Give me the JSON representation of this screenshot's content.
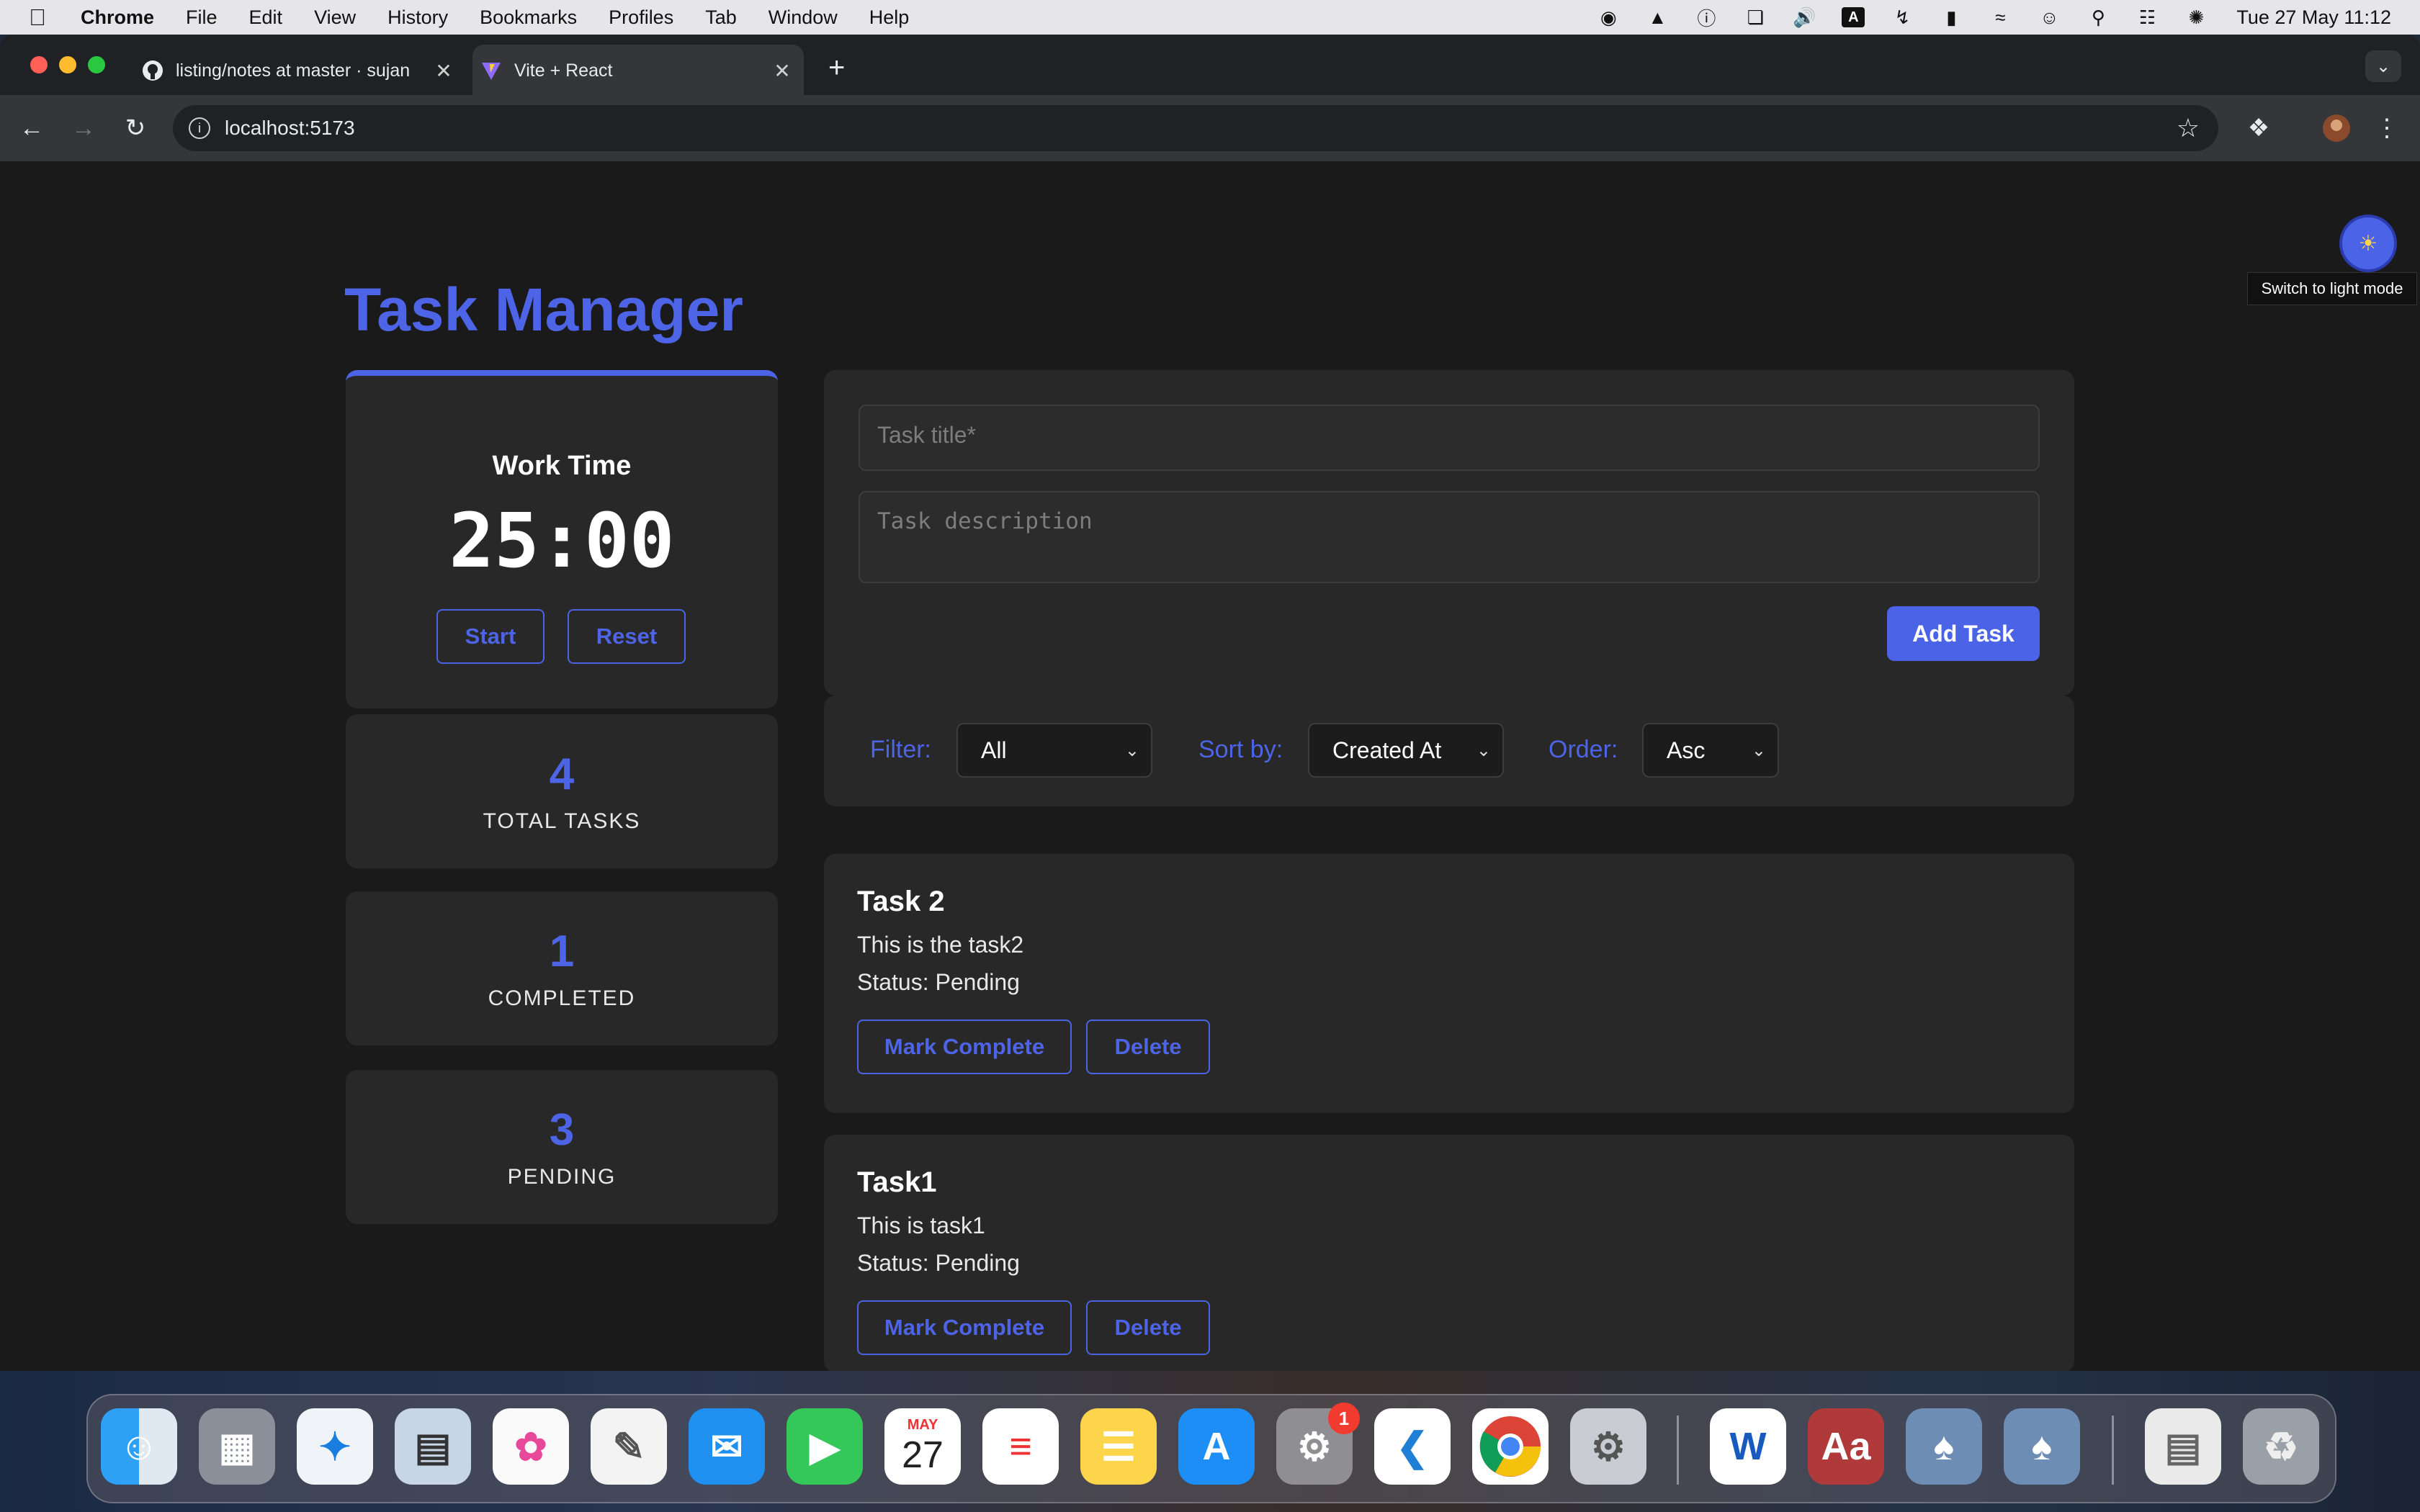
{
  "menubar": {
    "app_name": "Chrome",
    "items": [
      "File",
      "Edit",
      "View",
      "History",
      "Bookmarks",
      "Profiles",
      "Tab",
      "Window",
      "Help"
    ],
    "clock": "Tue 27 May  11:12"
  },
  "browser": {
    "tabs": [
      {
        "label": "listing/notes at master · sujan",
        "active": false
      },
      {
        "label": "Vite + React",
        "active": true
      }
    ],
    "url": "localhost:5173"
  },
  "page": {
    "title": "Task Manager",
    "theme_toggle_tooltip": "Switch to light mode",
    "timer": {
      "label": "Work Time",
      "time": "25:00",
      "start_label": "Start",
      "reset_label": "Reset"
    },
    "stats": [
      {
        "value": "4",
        "label": "TOTAL TASKS"
      },
      {
        "value": "1",
        "label": "COMPLETED"
      },
      {
        "value": "3",
        "label": "PENDING"
      }
    ],
    "form": {
      "title_placeholder": "Task title*",
      "description_placeholder": "Task description",
      "add_label": "Add Task"
    },
    "filters": {
      "filter_label": "Filter:",
      "filter_value": "All",
      "sort_label": "Sort by:",
      "sort_value": "Created At",
      "order_label": "Order:",
      "order_value": "Asc"
    },
    "tasks": [
      {
        "title": "Task 2",
        "description": "This is the task2",
        "status": "Status: Pending",
        "complete_label": "Mark Complete",
        "delete_label": "Delete"
      },
      {
        "title": "Task1",
        "description": "This is task1",
        "status": "Status: Pending",
        "complete_label": "Mark Complete",
        "delete_label": "Delete"
      }
    ]
  },
  "dock": {
    "calendar_month": "MAY",
    "calendar_day": "27",
    "settings_badge": "1",
    "apps": [
      "finder-icon",
      "launchpad-icon",
      "safari-icon",
      "preview-icon",
      "photos-icon",
      "textedit-icon",
      "mail-icon",
      "facetime-icon",
      "calendar-icon",
      "reminders-icon",
      "notes-icon",
      "app-store-icon",
      "system-settings-icon",
      "vscode-icon",
      "chrome-icon",
      "settings-gear-icon",
      "word-icon",
      "dictionary-icon",
      "postgres-icon",
      "postgres-icon-2",
      "document-icon",
      "trash-icon"
    ]
  },
  "colors": {
    "accent": "#4a63e7",
    "page_bg": "#1a1a1a",
    "card_bg": "#282828"
  }
}
